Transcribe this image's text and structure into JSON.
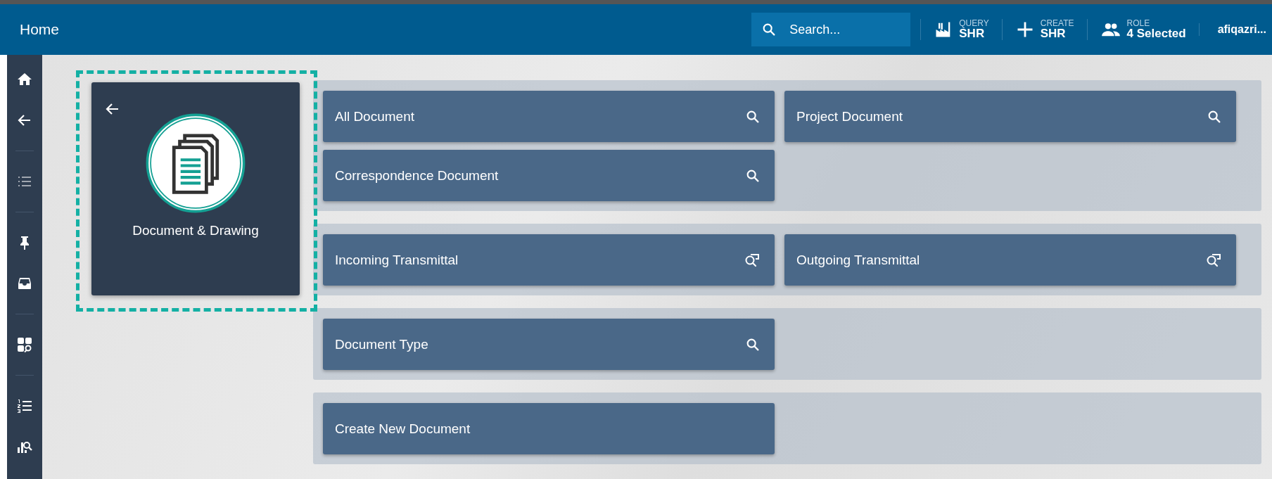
{
  "header": {
    "title": "Home",
    "search": {
      "placeholder": "Search..."
    },
    "actions": [
      {
        "kind": "query",
        "caption": "QUERY",
        "value": "SHR"
      },
      {
        "kind": "create",
        "caption": "CREATE",
        "value": "SHR"
      },
      {
        "kind": "role",
        "caption": "ROLE",
        "value": "4 Selected"
      }
    ],
    "user": "afiqazri..."
  },
  "sidebar": {
    "groups": [
      [
        {
          "kind": "home",
          "disabled": false
        },
        {
          "kind": "back",
          "disabled": false
        }
      ],
      [
        {
          "kind": "list",
          "disabled": true
        }
      ],
      [
        {
          "kind": "pin",
          "disabled": false
        },
        {
          "kind": "inbox",
          "disabled": false
        }
      ],
      [
        {
          "kind": "dashboard-search",
          "disabled": false
        }
      ],
      [
        {
          "kind": "numbered-list",
          "disabled": false
        },
        {
          "kind": "chart-search",
          "disabled": false
        }
      ]
    ]
  },
  "module_card": {
    "title": "Document & Drawing",
    "highlighted": true
  },
  "groups": [
    {
      "items": [
        {
          "label": "All Document",
          "kind": "search"
        },
        {
          "label": "Project Document",
          "kind": "search"
        },
        {
          "label": "Correspondence Document",
          "kind": "search"
        }
      ]
    },
    {
      "items": [
        {
          "label": "Incoming Transmittal",
          "kind": "transmittal"
        },
        {
          "label": "Outgoing Transmittal",
          "kind": "transmittal"
        }
      ]
    },
    {
      "items": [
        {
          "label": "Document Type",
          "kind": "search"
        }
      ]
    },
    {
      "items": [
        {
          "label": "Create New Document",
          "kind": "create"
        }
      ]
    }
  ]
}
